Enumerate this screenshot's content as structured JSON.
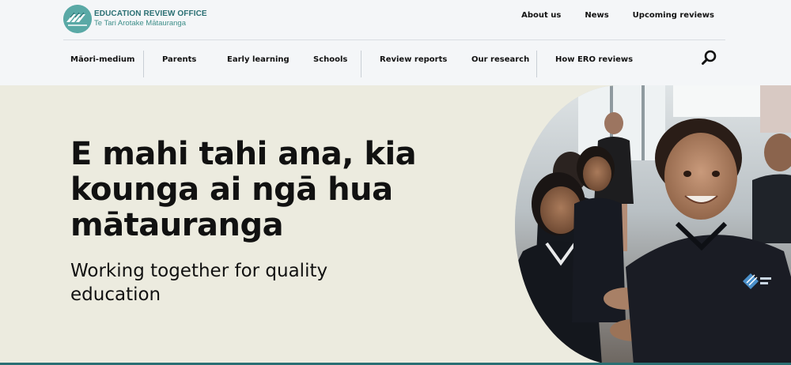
{
  "header": {
    "logo": {
      "title": "EDUCATION REVIEW OFFICE",
      "subtitle": "Te Tari Arotake Mātauranga"
    },
    "utility_nav": [
      "About us",
      "News",
      "Upcoming reviews"
    ]
  },
  "main_nav": {
    "items": [
      "Māori-medium",
      "Parents",
      "Early learning",
      "Schools",
      "Review reports",
      "Our research",
      "How ERO reviews"
    ],
    "search_icon": "search-icon"
  },
  "hero": {
    "heading": "E mahi tahi ana, kia kounga ai ngā hua mātauranga",
    "subheading": "Working together for quality education",
    "image_description_icon": "photo-students"
  },
  "colors": {
    "brand_teal": "#2a6f73",
    "logo_teal": "#5aa9a6",
    "hero_background": "#ecebdf",
    "header_background": "#f4f6f8"
  }
}
